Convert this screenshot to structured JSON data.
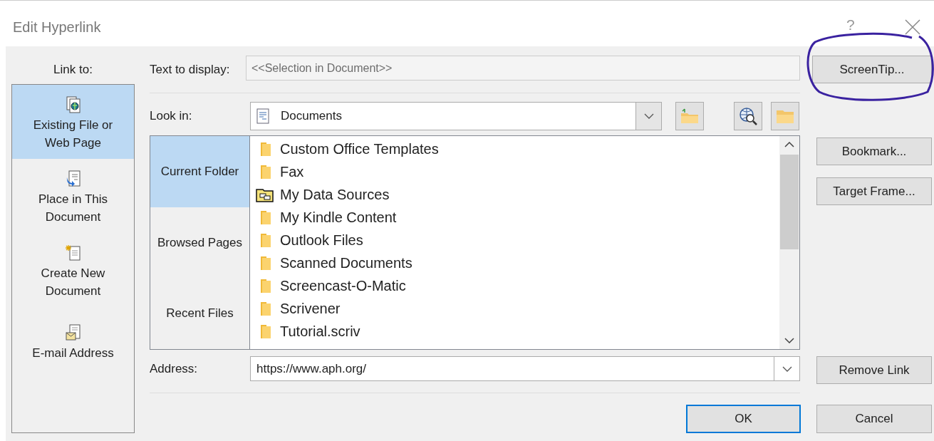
{
  "window": {
    "title": "Edit Hyperlink",
    "help": "?"
  },
  "link_to": {
    "label": "Link to:",
    "items": [
      {
        "kind": "file",
        "label": "Existing File or Web Page",
        "selected": true
      },
      {
        "kind": "place",
        "label": "Place in This Document",
        "selected": false
      },
      {
        "kind": "new",
        "label": "Create New Document",
        "selected": false
      },
      {
        "kind": "email",
        "label": "E-mail Address",
        "selected": false
      }
    ]
  },
  "text_to_display": {
    "label": "Text to display:",
    "value": "<<Selection in Document>>"
  },
  "look_in": {
    "label": "Look in:",
    "value": "Documents"
  },
  "sources": [
    {
      "label": "Current Folder",
      "selected": true
    },
    {
      "label": "Browsed Pages",
      "selected": false
    },
    {
      "label": "Recent Files",
      "selected": false
    }
  ],
  "files": [
    {
      "kind": "folder",
      "name": "Custom Office Templates"
    },
    {
      "kind": "folder",
      "name": "Fax"
    },
    {
      "kind": "data",
      "name": "My Data Sources"
    },
    {
      "kind": "folder",
      "name": "My Kindle Content"
    },
    {
      "kind": "folder",
      "name": "Outlook Files"
    },
    {
      "kind": "folder",
      "name": "Scanned Documents"
    },
    {
      "kind": "folder",
      "name": "Screencast-O-Matic"
    },
    {
      "kind": "folder",
      "name": "Scrivener"
    },
    {
      "kind": "folder",
      "name": "Tutorial.scriv"
    }
  ],
  "address": {
    "label": "Address:",
    "value": "https://www.aph.org/"
  },
  "side_buttons": [
    {
      "kind": "screentip",
      "label": "ScreenTip..."
    },
    {
      "kind": "list",
      "label": "Bookmark..."
    },
    {
      "kind": "list",
      "label": "Target Frame..."
    },
    {
      "kind": "address",
      "label": "Remove Link"
    }
  ],
  "buttons": [
    {
      "label": "OK",
      "default": true
    },
    {
      "label": "Cancel",
      "default": false
    }
  ]
}
